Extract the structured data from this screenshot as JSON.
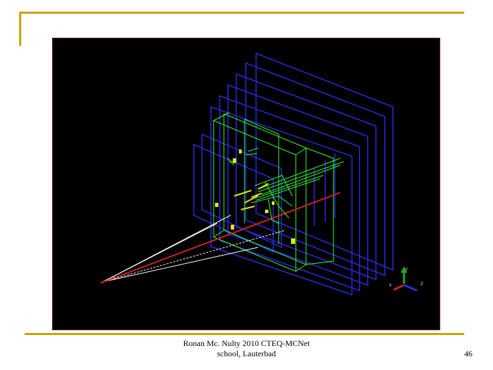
{
  "slide": {
    "accent_color": "#c8a400",
    "footer_line1": "Ronan Mc. Nulty 2010 CTEQ-MCNet",
    "footer_line2": "school, Lauterbad",
    "page_number": "46"
  },
  "event_display": {
    "background_color": "#000000",
    "colors": {
      "station_planes": "#2b2bdc",
      "tracks": "#33ff33",
      "track_segments": "#e8e800",
      "beam_axis": "#d02020",
      "vertex_lines": "#ffffff"
    },
    "axes": {
      "y_label": "Y",
      "x_label": "X",
      "z_label": "Z",
      "y_icon": "green-arrow-icon",
      "x_icon": "red-arrow-icon",
      "z_icon": "blue-arrow-icon"
    }
  }
}
